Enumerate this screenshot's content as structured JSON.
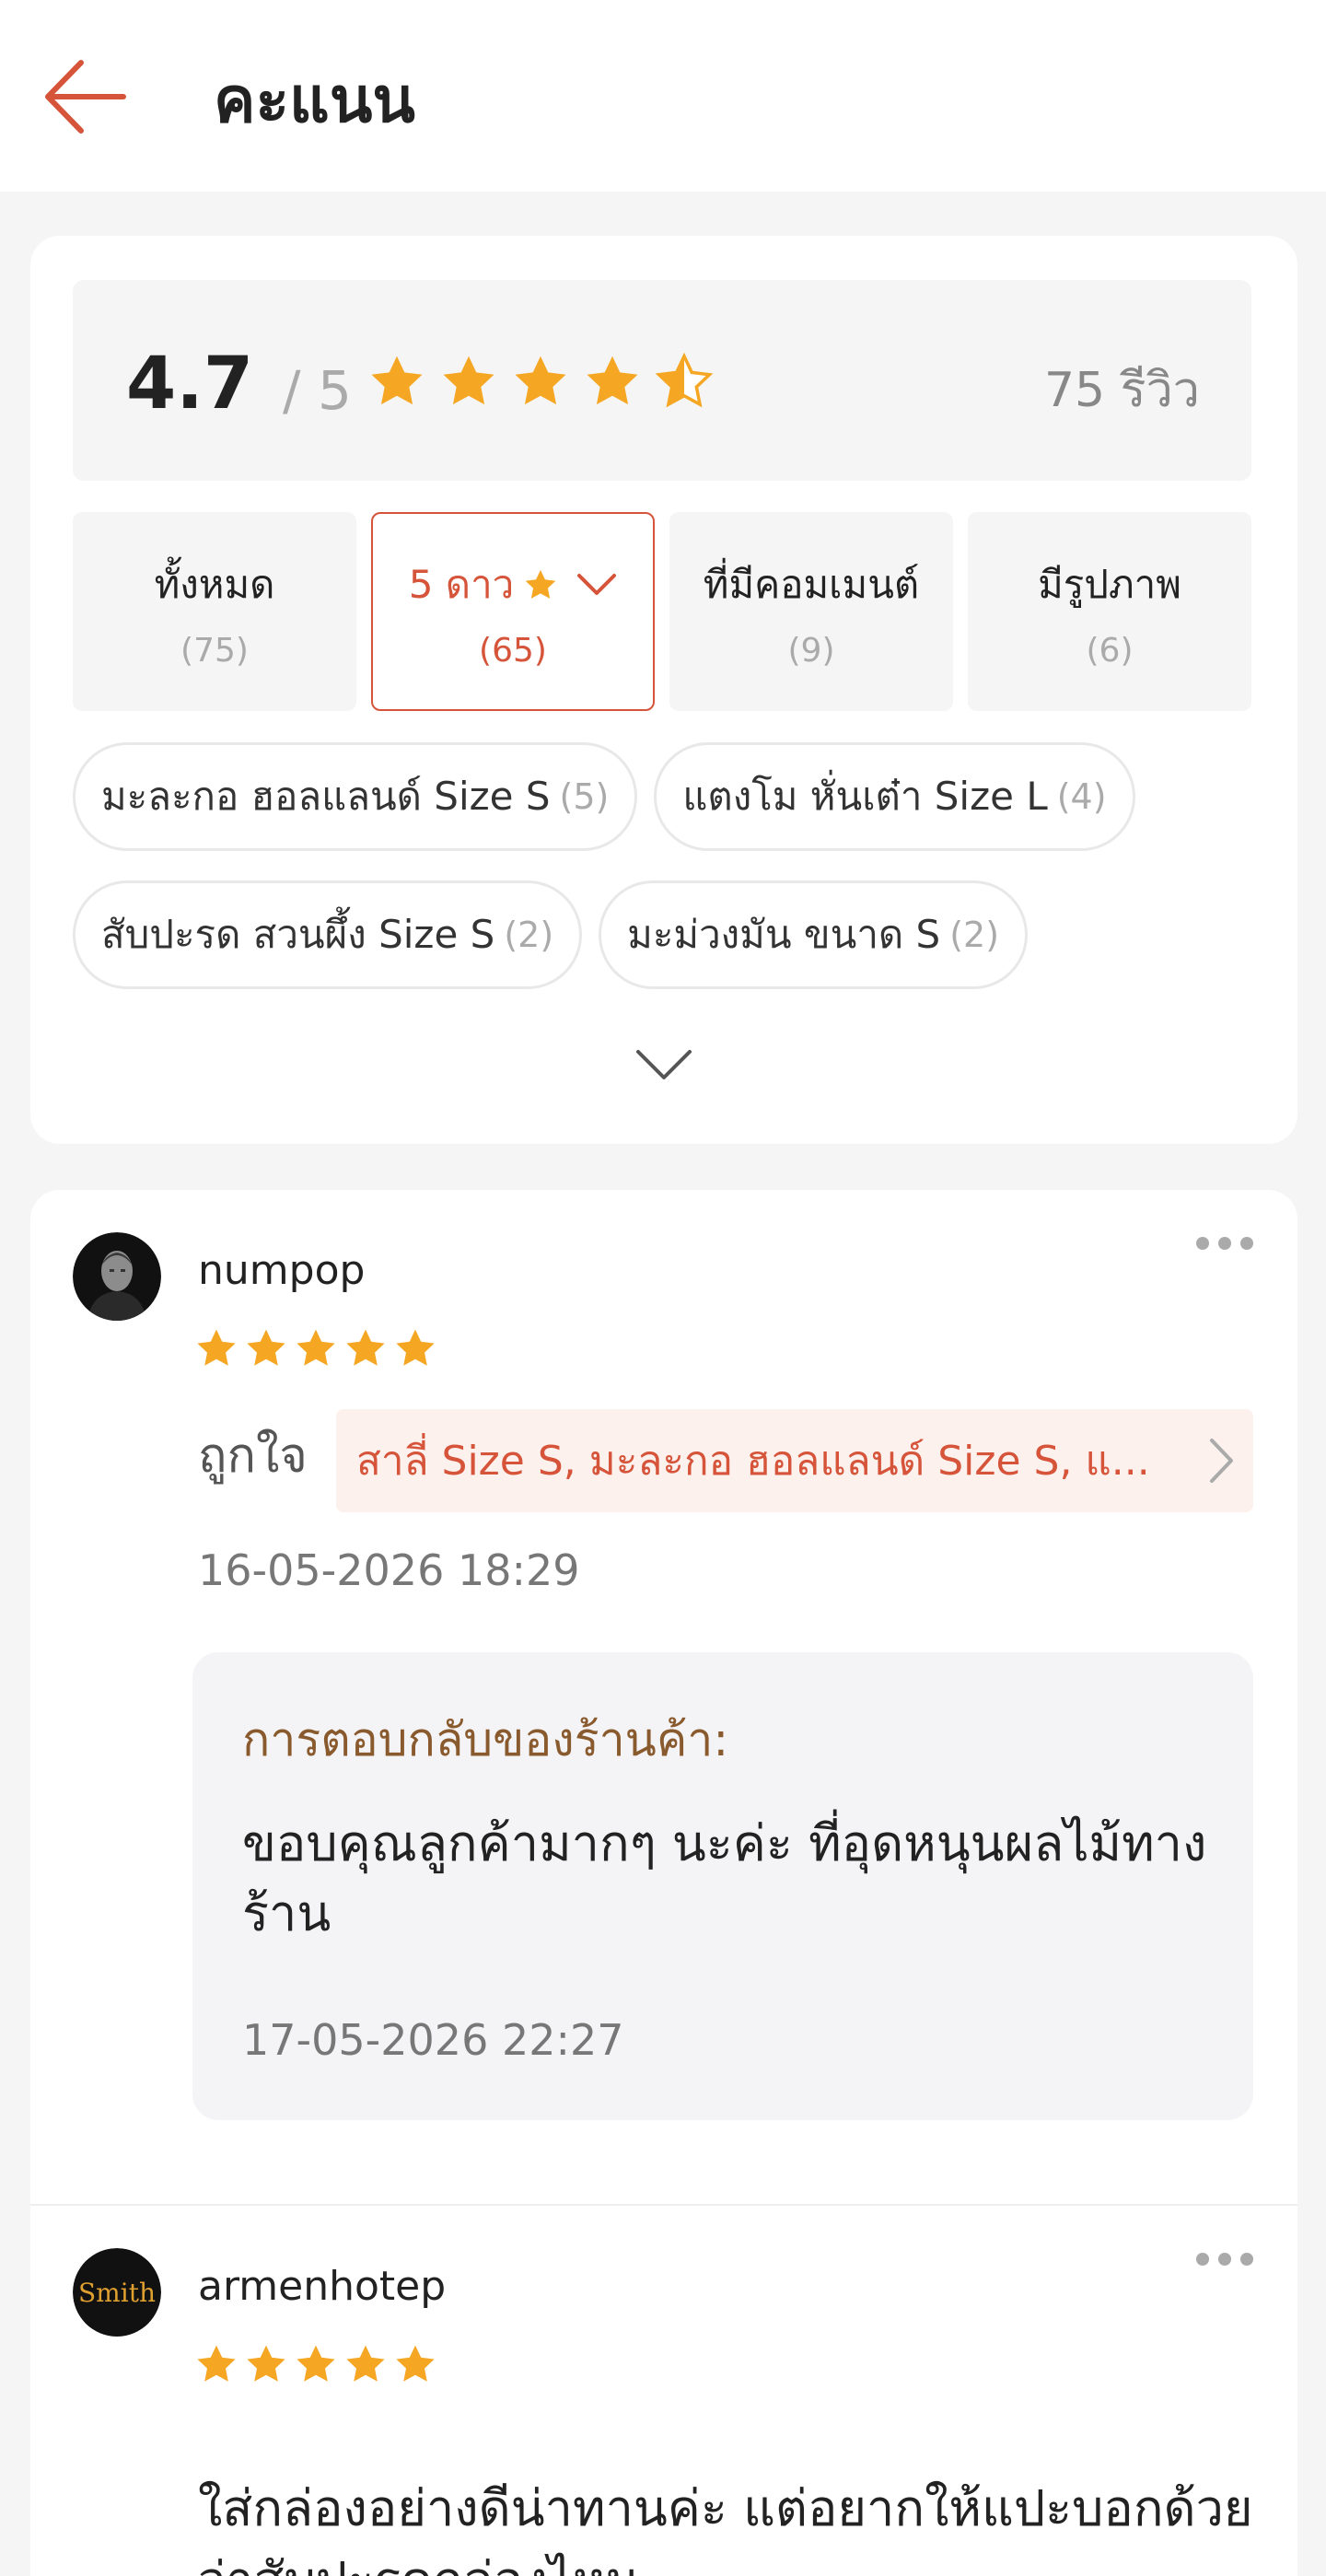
{
  "header": {
    "title": "คะแนน",
    "back_icon": "arrow-left-icon"
  },
  "colors": {
    "accent": "#d5543a",
    "star": "#f5a623",
    "reply_title": "#8a5a2f"
  },
  "summary": {
    "rating": "4.7",
    "rating_max": "/ 5",
    "rating_stars": 4.5,
    "review_count": "75 รีวิว"
  },
  "filters": [
    {
      "label": "ทั้งหมด",
      "count": "(75)"
    },
    {
      "label": "5 ดาว",
      "count": "(65)",
      "active": true
    },
    {
      "label": "ที่มีคอมเมนต์",
      "count": "(9)"
    },
    {
      "label": "มีรูปภาพ",
      "count": "(6)"
    }
  ],
  "variant_chips": [
    {
      "name": "มะละกอ ฮอลแลนด์ Size S",
      "count": "(5)"
    },
    {
      "name": "แตงโม หั่นเต๋า Size L",
      "count": "(4)"
    },
    {
      "name": "สับปะรด สวนผึ้ง Size S",
      "count": "(2)"
    },
    {
      "name": "มะม่วงมัน ขนาด S",
      "count": "(2)"
    }
  ],
  "reviews": [
    {
      "username": "numpop",
      "stars": 5,
      "like_label": "ถูกใจ",
      "variants": "สาลี่ Size S, มะละกอ ฮอลแลนด์ Size S, แ...",
      "date": "16-05-2026 18:29",
      "reply": {
        "title": "การตอบกลับของร้านค้า:",
        "text": "ขอบคุณลูกค้ามากๆ นะค่ะ ที่อุดหนุนผลไม้ทางร้าน",
        "date": "17-05-2026 22:27"
      }
    },
    {
      "username": "armenhotep",
      "avatar_text": "Smith",
      "stars": 5,
      "text": "ใส่กล่องอย่างดีน่าทานค่ะ แต่อยากให้แปะบอกด้วยว่าสับปะรดกล่องไหน"
    }
  ]
}
